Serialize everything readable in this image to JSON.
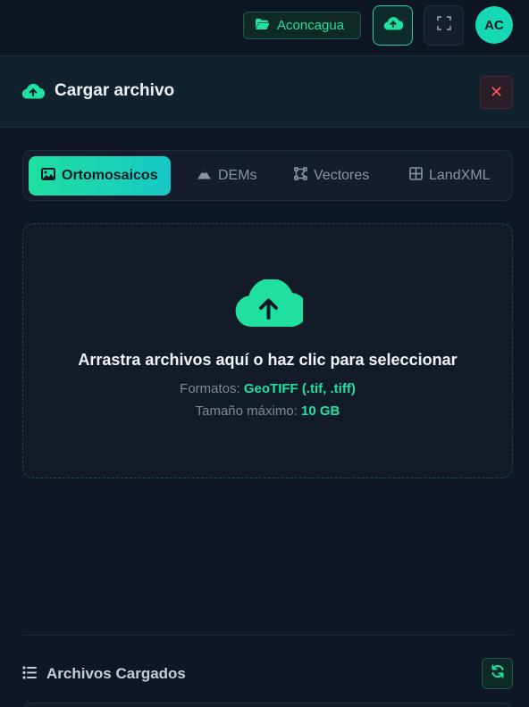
{
  "topbar": {
    "project_label": "Aconcagua",
    "avatar_initials": "AC"
  },
  "panel": {
    "title": "Cargar archivo",
    "close_label": "✕"
  },
  "tabs": [
    {
      "label": "Ortomosaicos",
      "icon": "image-icon",
      "active": true
    },
    {
      "label": "DEMs",
      "icon": "mountain-icon",
      "active": false
    },
    {
      "label": "Vectores",
      "icon": "vector-icon",
      "active": false
    },
    {
      "label": "LandXML",
      "icon": "grid-icon",
      "active": false
    }
  ],
  "dropzone": {
    "title": "Arrastra archivos aquí o haz clic para seleccionar",
    "formats_label": "Formatos:",
    "formats_value": "GeoTIFF (.tif, .tiff)",
    "max_size_label": "Tamaño máximo:",
    "max_size_value": "10 GB"
  },
  "files": {
    "title": "Archivos Cargados"
  },
  "colors": {
    "accent": "#20e0a0",
    "background": "#0f1626",
    "danger": "#ff5a5a"
  }
}
